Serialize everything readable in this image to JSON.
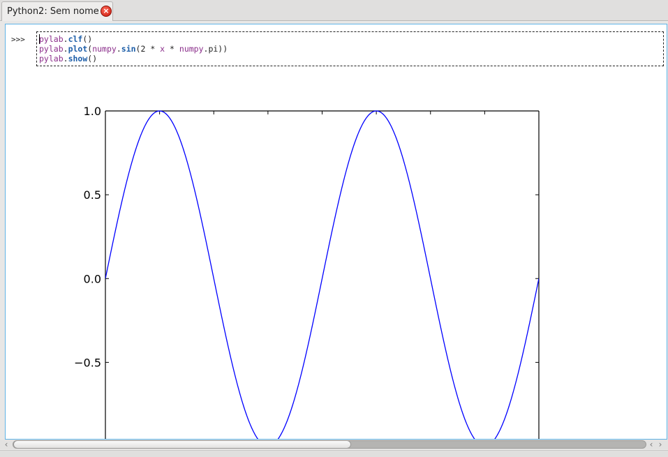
{
  "tab": {
    "label": "Python2: Sem nome",
    "close_icon": "close-icon"
  },
  "console": {
    "prompt": ">>>",
    "code_lines": [
      {
        "module": "pylab",
        "dot": ".",
        "func": "clf",
        "rest": "()"
      },
      {
        "module": "pylab",
        "dot": ".",
        "func": "plot",
        "rest_pre": "(",
        "inner_mod": "numpy",
        "inner_dot": ".",
        "inner_fn": "sin",
        "inner_rest_a": "(2 * ",
        "var_x": "x",
        "inner_rest_b": " * ",
        "inner_mod2": "numpy",
        "inner_rest_c": ".pi))"
      },
      {
        "module": "pylab",
        "dot": ".",
        "func": "show",
        "rest": "()"
      }
    ]
  },
  "chart_data": {
    "type": "line",
    "function": "sin(2*pi*x)",
    "x_range": [
      0,
      2.0
    ],
    "xlim": [
      0,
      2.0
    ],
    "ylim": [
      -1.0,
      1.0
    ],
    "y_ticks": [
      1.0,
      0.5,
      0.0,
      -0.5
    ],
    "y_tick_labels": [
      "1.0",
      "0.5",
      "0.0",
      "−0.5"
    ],
    "series": [
      {
        "color": "#0000ff"
      }
    ],
    "grid": false
  },
  "scrollbar": {
    "left_icon": "chevron-left-icon",
    "right_icon": "chevron-right-icon"
  }
}
